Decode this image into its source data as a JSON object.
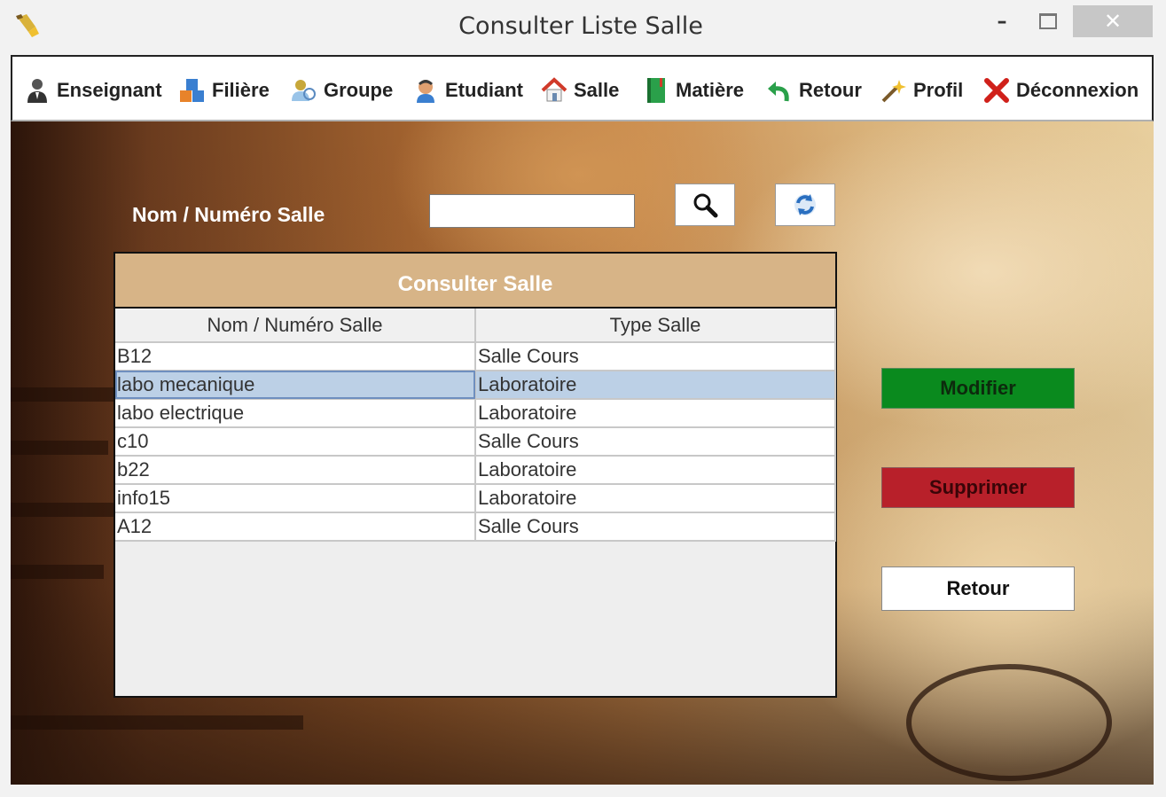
{
  "window": {
    "title": "Consulter Liste Salle",
    "close_glyph": "✕",
    "minimize_glyph": "–"
  },
  "menu": [
    {
      "label": "Enseignant",
      "icon": "teacher-icon"
    },
    {
      "label": "Filière",
      "icon": "blocks-icon"
    },
    {
      "label": "Groupe",
      "icon": "group-icon"
    },
    {
      "label": "Etudiant",
      "icon": "student-icon"
    },
    {
      "label": "Salle",
      "icon": "house-icon"
    },
    {
      "label": "Matière",
      "icon": "book-icon"
    },
    {
      "label": "Retour",
      "icon": "back-arrow-icon"
    },
    {
      "label": "Profil",
      "icon": "wand-icon"
    },
    {
      "label": "Déconnexion",
      "icon": "close-x-icon"
    }
  ],
  "search": {
    "label": "Nom / Numéro Salle",
    "value": "",
    "search_icon": "magnifier-icon",
    "refresh_icon": "refresh-icon"
  },
  "panel": {
    "title": "Consulter Salle",
    "columns": [
      "Nom / Numéro Salle",
      "Type Salle"
    ],
    "rows": [
      [
        "B12",
        "Salle Cours"
      ],
      [
        "labo mecanique",
        "Laboratoire"
      ],
      [
        "labo electrique",
        "Laboratoire"
      ],
      [
        "c10",
        "Salle Cours"
      ],
      [
        "b22",
        "Laboratoire"
      ],
      [
        "info15",
        "Laboratoire"
      ],
      [
        "A12",
        "Salle Cours"
      ]
    ],
    "selected_row": 1
  },
  "buttons": {
    "modify": "Modifier",
    "delete": "Supprimer",
    "back": "Retour"
  },
  "colors": {
    "header_bg": "#d7b487",
    "selection": "#bcd0e6",
    "modify_bg": "#0a8a1e",
    "delete_bg": "#b8202a"
  }
}
